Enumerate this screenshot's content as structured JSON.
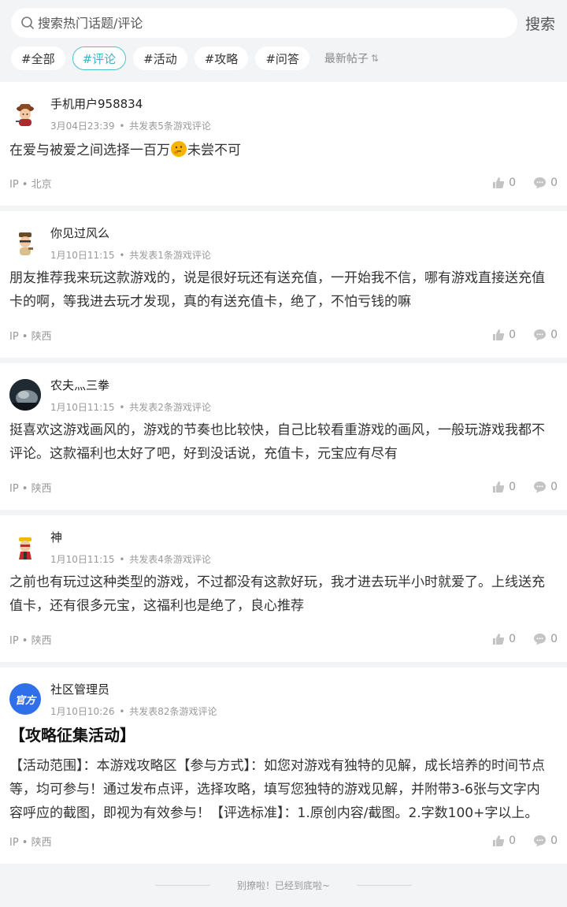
{
  "search": {
    "placeholder": "搜索热门话题/评论",
    "button_label": "搜索"
  },
  "tabs": [
    {
      "label": "#全部",
      "active": false
    },
    {
      "label": "#评论",
      "active": true
    },
    {
      "label": "#活动",
      "active": false
    },
    {
      "label": "#攻略",
      "active": false
    },
    {
      "label": "#问答",
      "active": false
    }
  ],
  "sort_label": "最新帖子",
  "posts": [
    {
      "author": "手机用户958834",
      "time": "3月04日23:39",
      "stats": "共发表5条游戏评论",
      "content_before": "在爱与被爱之间选择一百万",
      "content_after": "未尝不可",
      "ip": "IP • 北京",
      "likes": "0",
      "comments": "0"
    },
    {
      "author": "你见过风么",
      "time": "1月10日11:15",
      "stats": "共发表1条游戏评论",
      "content": "朋友推荐我来玩这款游戏的，说是很好玩还有送充值，一开始我不信，哪有游戏直接送充值卡的啊，等我进去玩才发现，真的有送充值卡，绝了，不怕亏钱的嘛",
      "ip": "IP • 陕西",
      "likes": "0",
      "comments": "0"
    },
    {
      "author": "农夫灬三拳",
      "time": "1月10日11:15",
      "stats": "共发表2条游戏评论",
      "content": "挺喜欢这游戏画风的，游戏的节奏也比较快，自己比较看重游戏的画风，一般玩游戏我都不评论。这款福利也太好了吧，好到没话说，充值卡，元宝应有尽有",
      "ip": "IP • 陕西",
      "likes": "0",
      "comments": "0"
    },
    {
      "author": "神",
      "time": "1月10日11:15",
      "stats": "共发表4条游戏评论",
      "content": "之前也有玩过这种类型的游戏，不过都没有这款好玩，我才进去玩半小时就爱了。上线送充值卡，还有很多元宝，这福利也是绝了，良心推荐",
      "ip": "IP • 陕西",
      "likes": "0",
      "comments": "0"
    },
    {
      "author": "社区管理员",
      "badge": "官方",
      "time": "1月10日10:26",
      "stats": "共发表82条游戏评论",
      "title": "【攻略征集活动】",
      "content": "【活动范围】：本游戏攻略区【参与方式】：如您对游戏有独特的见解，成长培养的时间节点等，均可参与！通过发布点评，选择攻略，填写您独特的游戏见解，并附带3-6张与文字内容呼应的截图，即视为有效参与！【评选标准】：1.原创内容/截图。2.字数100+字以上。",
      "ip": "IP • 陕西",
      "likes": "0",
      "comments": "0"
    }
  ],
  "end_text": "别撩啦！已经到底啦~",
  "colors": {
    "accent": "#3fb4c2",
    "official_badge": "#2f6fea"
  }
}
